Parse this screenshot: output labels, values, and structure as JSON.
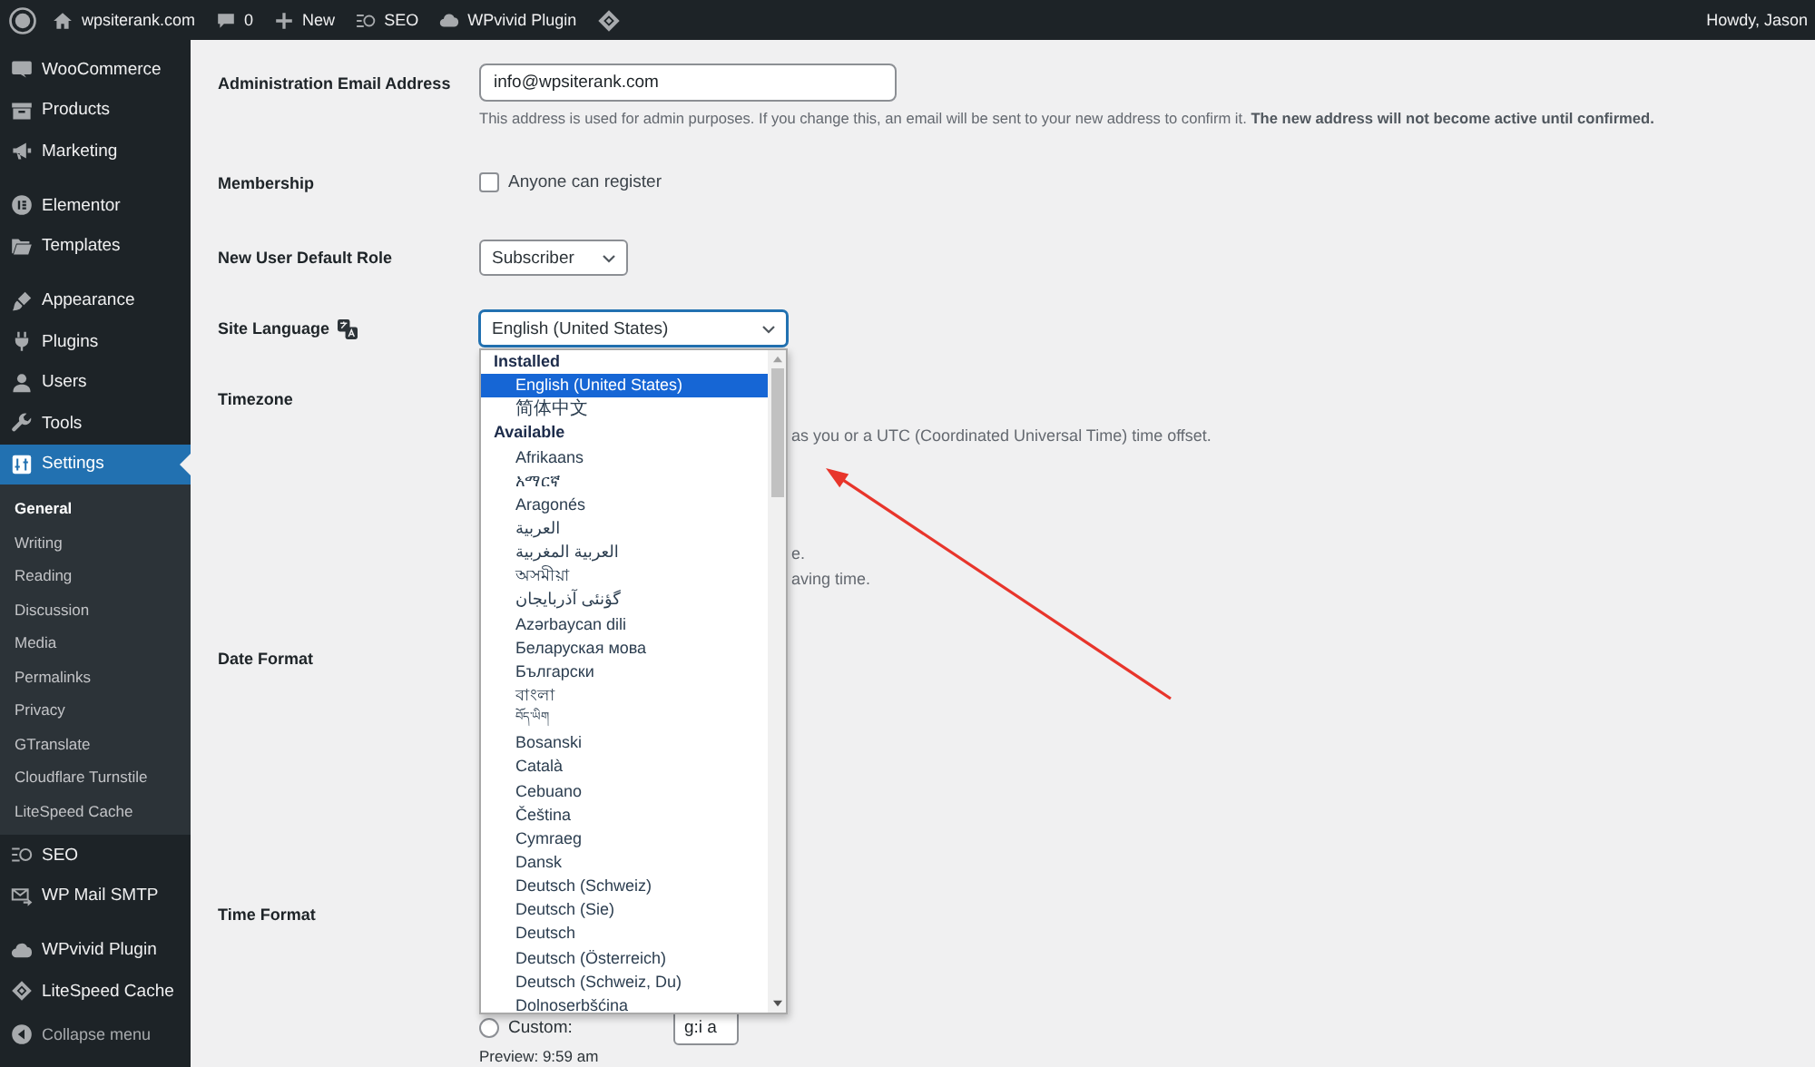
{
  "admin_bar": {
    "site": "wpsiterank.com",
    "comments": "0",
    "new": "New",
    "seo": "SEO",
    "plugin": "WPvivid Plugin",
    "greeting": "Howdy, Jason"
  },
  "sidebar": {
    "sections": [
      {
        "items": [
          {
            "label": "WooCommerce",
            "selected": false
          },
          {
            "label": "Products",
            "selected": false
          },
          {
            "label": "Marketing",
            "selected": false
          }
        ]
      },
      {
        "items": [
          {
            "label": "Elementor",
            "selected": false
          },
          {
            "label": "Templates",
            "selected": false
          }
        ]
      },
      {
        "items": [
          {
            "label": "Appearance",
            "selected": false
          },
          {
            "label": "Plugins",
            "selected": false
          },
          {
            "label": "Users",
            "selected": false
          },
          {
            "label": "Tools",
            "selected": false
          },
          {
            "label": "Settings",
            "selected": true,
            "children": [
              {
                "label": "General",
                "selected": true
              },
              {
                "label": "Writing",
                "selected": false
              },
              {
                "label": "Reading",
                "selected": false
              },
              {
                "label": "Discussion",
                "selected": false
              },
              {
                "label": "Media",
                "selected": false
              },
              {
                "label": "Permalinks",
                "selected": false
              },
              {
                "label": "Privacy",
                "selected": false
              },
              {
                "label": "GTranslate",
                "selected": false
              },
              {
                "label": "Cloudflare Turnstile",
                "selected": false
              },
              {
                "label": "LiteSpeed Cache",
                "selected": false
              }
            ]
          },
          {
            "label": "SEO",
            "selected": false
          },
          {
            "label": "WP Mail SMTP",
            "selected": false
          }
        ]
      },
      {
        "items": [
          {
            "label": "WPvivid Plugin",
            "selected": false
          },
          {
            "label": "LiteSpeed Cache",
            "selected": false
          }
        ]
      }
    ],
    "collapse": "Collapse menu"
  },
  "form": {
    "rows": [
      {
        "kind": "email",
        "label": "Administration Email Address",
        "value": "info@wpsiterank.com",
        "description": "This address is used for admin purposes. If you change this, an email will be sent to your new address to confirm it. **The new address will not become active until confirmed.**"
      },
      {
        "kind": "checkbox",
        "label": "Membership",
        "option": "Anyone can register",
        "checked": false
      },
      {
        "kind": "select",
        "label": "New User Default Role",
        "value": "Subscriber"
      },
      {
        "kind": "language",
        "label": "Site Language",
        "value": "English (United States)",
        "expanded": true,
        "groups": [
          {
            "label": "Installed",
            "options": [
              {
                "label": "English (United States)",
                "selected": true
              },
              {
                "label": "简体中文",
                "selected": false
              }
            ]
          },
          {
            "label": "Available",
            "options": [
              {
                "label": "Afrikaans",
                "selected": false
              },
              {
                "label": "አማርኛ",
                "selected": false
              },
              {
                "label": "Aragonés",
                "selected": false
              },
              {
                "label": "العربية",
                "selected": false
              },
              {
                "label": "العربية المغربية",
                "selected": false
              },
              {
                "label": "অসমীয়া",
                "selected": false
              },
              {
                "label": "گؤنئی آذربایجان",
                "selected": false
              },
              {
                "label": "Azərbaycan dili",
                "selected": false
              },
              {
                "label": "Беларуская мова",
                "selected": false
              },
              {
                "label": "Български",
                "selected": false
              },
              {
                "label": "বাংলা",
                "selected": false
              },
              {
                "label": "བོད་ཡིག",
                "selected": false
              },
              {
                "label": "Bosanski",
                "selected": false
              },
              {
                "label": "Català",
                "selected": false
              },
              {
                "label": "Cebuano",
                "selected": false
              },
              {
                "label": "Čeština",
                "selected": false
              },
              {
                "label": "Cymraeg",
                "selected": false
              },
              {
                "label": "Dansk",
                "selected": false
              },
              {
                "label": "Deutsch (Schweiz)",
                "selected": false
              },
              {
                "label": "Deutsch (Sie)",
                "selected": false
              },
              {
                "label": "Deutsch",
                "selected": false
              },
              {
                "label": "Deutsch (Österreich)",
                "selected": false
              },
              {
                "label": "Deutsch (Schweiz, Du)",
                "selected": false
              },
              {
                "label": "Dolnoserbšćina",
                "selected": false
              }
            ]
          }
        ]
      },
      {
        "kind": "timezone",
        "label": "Timezone",
        "notes": [
          "as you or a UTC (Coordinated Universal Time) time offset.",
          "e.",
          "aving time."
        ]
      },
      {
        "kind": "date_format",
        "label": "Date Format"
      },
      {
        "kind": "time_format",
        "label": "Time Format",
        "custom": {
          "label": "Custom:",
          "selected": false,
          "value": "g:i a"
        },
        "preview": "Preview: 9:59 am"
      }
    ]
  },
  "annotations": [
    {
      "kind": "arrow"
    }
  ]
}
